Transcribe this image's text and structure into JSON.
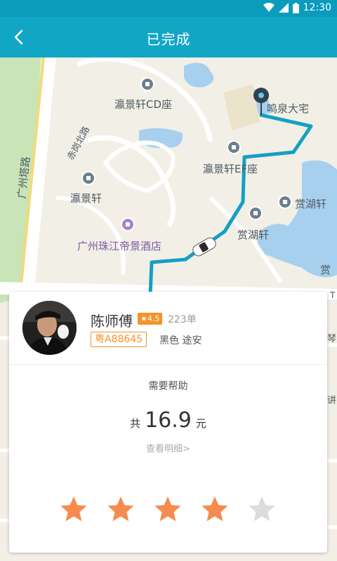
{
  "status_bar": {
    "time": "12:30"
  },
  "header": {
    "title": "已完成"
  },
  "map": {
    "labels": {
      "cd": "瀛景轩CD座",
      "ef": "瀛景轩EF座",
      "yjx": "瀛景轩",
      "chx": "赏湖轩",
      "chx_right": "赏湖轩",
      "hotel": "广州珠江帝景酒店",
      "road_gz": "广州塔路",
      "road_cg": "赤岗北路",
      "ldq": "鸣泉大宅",
      "edge1": "赏",
      "edge2": "琴",
      "edge3": "T",
      "edge4": "讲"
    }
  },
  "driver": {
    "name": "陈师傅",
    "rating": "★4.5",
    "orders": "223单",
    "plate": "粤A88645",
    "car": "黑色 途安"
  },
  "help": "需要帮助",
  "fare": {
    "prefix": "共",
    "amount": "16.9",
    "unit": "元"
  },
  "detail_link": "查看明细>",
  "rating_stars": {
    "value": 4,
    "max": 5
  },
  "colors": {
    "accent": "#12a6c6",
    "status_bar": "#0b9bbd",
    "orange": "#f5922a",
    "route": "#13a0c2",
    "star_on": "#f68b4f",
    "star_off": "#dcdcdc"
  }
}
